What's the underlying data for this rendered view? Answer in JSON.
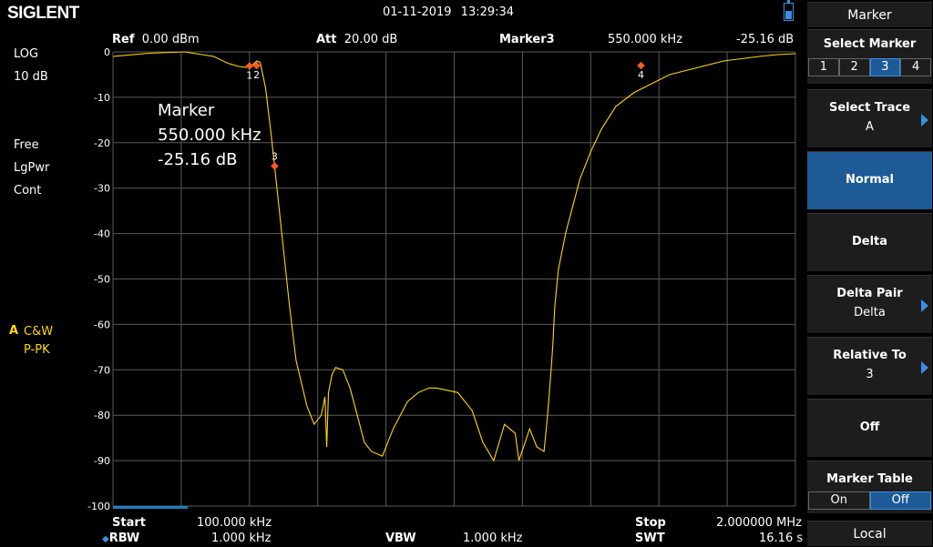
{
  "header": {
    "brand": "SIGLENT",
    "datetime": "01-11-2019   13:29:34",
    "ref_label": "Ref",
    "ref_value": "0.00 dBm",
    "att_label": "Att",
    "att_value": "20.00 dB",
    "marker_name": "Marker3",
    "marker_freq": "550.000 kHz",
    "marker_amp": "-25.16 dB"
  },
  "left_info": {
    "scale_type": "LOG",
    "scale_div": "10 dB",
    "trig": "Free",
    "detector": "LgPwr",
    "sweep_mode": "Cont",
    "trace_letter": "A",
    "trace_mode": "C&W",
    "trace_det": "P-PK"
  },
  "marker_readout": {
    "title": "Marker",
    "freq": "550.000 kHz",
    "amp": "-25.16 dB"
  },
  "footer": {
    "start_label": "Start",
    "start_value": "100.000 kHz",
    "stop_label": "Stop",
    "stop_value": "2.000000 MHz",
    "rbw_label": "RBW",
    "rbw_value": "1.000 kHz",
    "vbw_label": "VBW",
    "vbw_value": "1.000 kHz",
    "swt_label": "SWT",
    "swt_value": "16.16 s"
  },
  "softkeys": {
    "menu_title": "Marker",
    "select_marker": "Select Marker",
    "marker_options": [
      "1",
      "2",
      "3",
      "4"
    ],
    "selected_marker": "3",
    "select_trace": "Select Trace",
    "select_trace_value": "A",
    "normal": "Normal",
    "delta": "Delta",
    "delta_pair": "Delta Pair",
    "delta_pair_value": "Delta",
    "relative_to": "Relative To",
    "relative_to_value": "3",
    "off": "Off",
    "marker_table": "Marker Table",
    "marker_table_on": "On",
    "marker_table_off": "Off",
    "local": "Local"
  },
  "colors": {
    "trace": "#ffd800",
    "accent": "#1e5a96",
    "marker": "#ff5a1f",
    "grid": "#5a5a5a"
  },
  "chart_data": {
    "type": "line",
    "x_unit": "Hz",
    "y_unit": "dB",
    "xlim": [
      100000,
      2000000
    ],
    "ylim": [
      -100,
      0
    ],
    "y_ticks": [
      "0",
      "-10",
      "-20",
      "-30",
      "-40",
      "-50",
      "-60",
      "-70",
      "-80",
      "-90",
      "-100"
    ],
    "grid": true,
    "series": [
      {
        "x": [
          100000,
          200000,
          300000,
          380000,
          420000,
          450000,
          470000,
          490000,
          500000,
          510000,
          525000,
          540000,
          550000,
          570000,
          590000,
          610000,
          640000,
          660000,
          680000,
          690000,
          695000,
          700000,
          710000,
          720000,
          740000,
          760000,
          780000,
          800000,
          820000,
          850000,
          880000,
          900000,
          920000,
          950000,
          980000,
          1000000,
          1030000,
          1060000,
          1090000,
          1100000,
          1130000,
          1160000,
          1190000,
          1220000,
          1230000,
          1260000,
          1280000,
          1300000,
          1310000,
          1320000,
          1325000,
          1330000,
          1340000,
          1360000,
          1380000,
          1400000,
          1430000,
          1460000,
          1500000,
          1550000,
          1600000,
          1650000,
          1700000,
          1750000,
          1800000,
          1850000,
          1900000,
          1950000,
          2000000
        ],
        "y": [
          -1.0,
          -0.3,
          0,
          -1.0,
          -2.5,
          -3.2,
          -3.4,
          -2.8,
          -2.0,
          -2.3,
          -8,
          -18,
          -25.2,
          -40,
          -55,
          -68,
          -78,
          -82,
          -80,
          -76,
          -87,
          -75,
          -71,
          -69.5,
          -70,
          -74,
          -80,
          -86,
          -88,
          -89,
          -83,
          -80,
          -77,
          -75,
          -74,
          -74,
          -74.5,
          -75,
          -78,
          -79,
          -86,
          -90,
          -82,
          -84,
          -90,
          -83,
          -87,
          -88,
          -80,
          -70,
          -64,
          -56,
          -48,
          -40,
          -34,
          -28,
          -22,
          -17,
          -12,
          -9,
          -7,
          -5,
          -4,
          -3,
          -2,
          -1.5,
          -1.0,
          -0.6,
          -0.4
        ]
      }
    ],
    "markers": [
      {
        "label": "1",
        "x": 480000,
        "y": -3.1
      },
      {
        "label": "2",
        "x": 500000,
        "y": -3.0
      },
      {
        "label": "3",
        "x": 550000,
        "y": -25.16
      },
      {
        "label": "4",
        "x": 1570000,
        "y": -3.0
      }
    ]
  }
}
